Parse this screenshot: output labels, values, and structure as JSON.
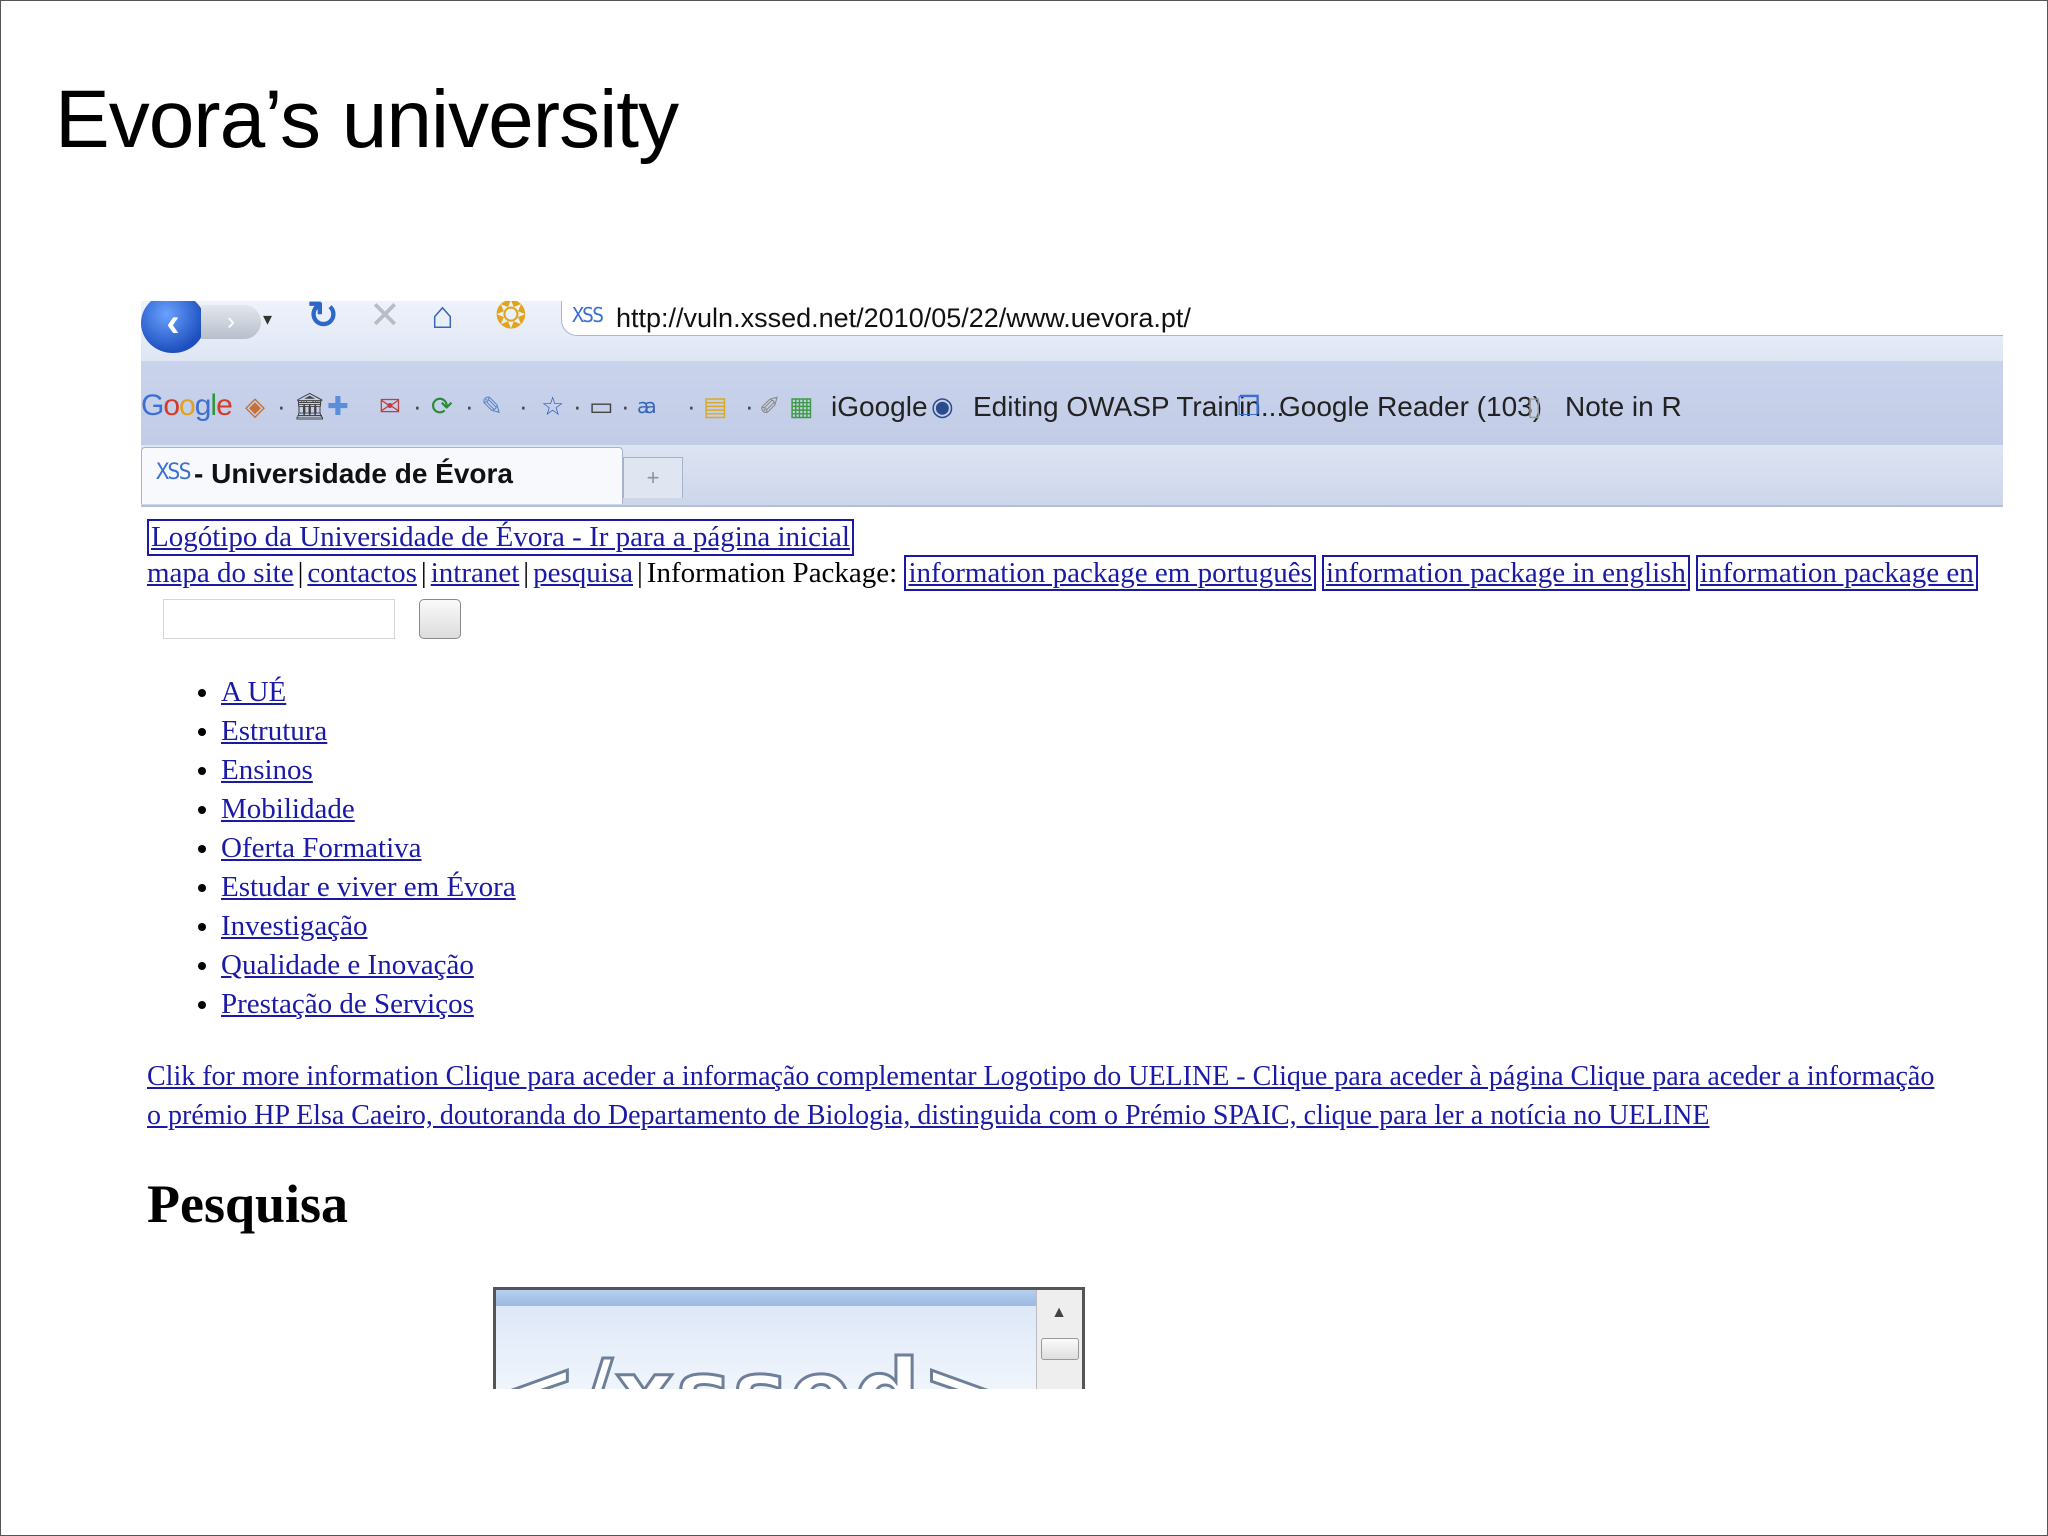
{
  "slide": {
    "title": "Evora’s university"
  },
  "browser": {
    "url": "http://vuln.xssed.net/2010/05/22/www.uevora.pt/",
    "site_icon": "XSS",
    "toolbar": {
      "google_logo": [
        "G",
        "o",
        "o",
        "g",
        "l",
        "e"
      ],
      "bookmarks": [
        {
          "label": "iGoogle",
          "icon": "igoogle-icon"
        },
        {
          "label": "Editing OWASP Trainin...",
          "icon": "globe-icon"
        },
        {
          "label": "Google Reader (103)",
          "icon": "reader-icon"
        },
        {
          "label": "Note in R",
          "icon": "page-icon"
        }
      ]
    },
    "tab": {
      "title": "- Universidade de Évora",
      "new_tab_glyph": "+"
    }
  },
  "page": {
    "logo_link": "Logótipo da Universidade de Évora - Ir para a página inicial",
    "nav_links": [
      "mapa do site",
      "contactos",
      "intranet",
      "pesquisa"
    ],
    "nav_separator": "|",
    "info_package_label": "Information Package:",
    "info_package_links": [
      "information package em português",
      "information package in english",
      "information package en"
    ],
    "menu": [
      "A UÉ",
      "Estrutura",
      "Ensinos",
      "Mobilidade",
      "Oferta Formativa",
      "Estudar e viver em Évora",
      "Investigação",
      "Qualidade e Inovação",
      "Prestação de Serviços"
    ],
    "news_line_1": "Clik for more information Clique para aceder a informação complementar Logotipo do UELINE - Clique para aceder à página Clique para aceder a informação",
    "news_line_2": "o prémio HP Elsa Caeiro, doutoranda do Departamento de Biologia, distinguida com o Prémio SPAIC, clique para ler a notícia no UELINE",
    "heading": "Pesquisa",
    "injected_logo_text": "</xssed>"
  }
}
